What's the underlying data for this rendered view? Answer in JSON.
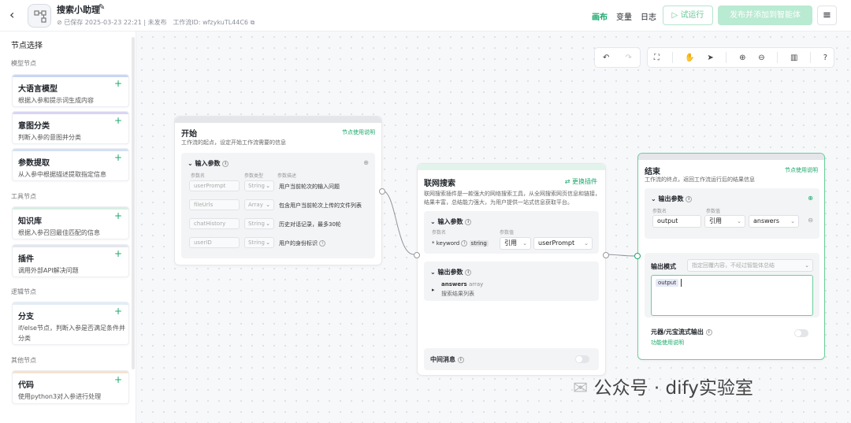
{
  "header": {
    "back_icon": "back-arrow-icon",
    "app_title": "搜索小助理",
    "meta": "已保存 2025-03-23 22:21 | 未发布",
    "workflow_id": "工作流ID: wfzykuTL44C6",
    "tabs": [
      {
        "label": "画布",
        "active": true
      },
      {
        "label": "变量",
        "active": false
      },
      {
        "label": "日志",
        "active": false
      }
    ],
    "run_label": "试运行",
    "publish_label": "发布并添加到智能体"
  },
  "sidebar": {
    "title": "节点选择",
    "sections": [
      {
        "label": "模型节点",
        "nodes": [
          {
            "title": "大语言模型",
            "desc": "根据入参和提示词生成内容",
            "color": "#c9d6f5"
          },
          {
            "title": "意图分类",
            "desc": "判断入参的意图并分类",
            "color": "#d9d4f3"
          },
          {
            "title": "参数提取",
            "desc": "从入参中根据描述提取指定信息",
            "color": "#d4dff4"
          }
        ]
      },
      {
        "label": "工具节点",
        "nodes": [
          {
            "title": "知识库",
            "desc": "根据入参召回最佳匹配的信息",
            "color": "#d9efe4"
          },
          {
            "title": "插件",
            "desc": "调用外部API解决问题",
            "color": "#e3e7ee"
          }
        ]
      },
      {
        "label": "逻辑节点",
        "nodes": [
          {
            "title": "分支",
            "desc": "if/else节点，判断入参是否满足条件并分类",
            "color": "#e3ecf7"
          }
        ]
      },
      {
        "label": "其他节点",
        "nodes": [
          {
            "title": "代码",
            "desc": "使用python3对入参进行处理",
            "color": "#f6e2cf"
          }
        ]
      }
    ]
  },
  "canvas": {
    "start": {
      "title": "开始",
      "link": "节点使用说明",
      "desc": "工作流的起点，设定开始工作流需要的信息",
      "input_label": "输入参数",
      "col_name": "参数名",
      "col_type": "参数类型",
      "col_desc": "参数描述",
      "rows": [
        {
          "name": "userPrompt",
          "type": "String",
          "desc": "用户当前轮次的输入问题"
        },
        {
          "name": "fileUrls",
          "type": "Array",
          "desc": "包含用户当前轮次上传的文件列表"
        },
        {
          "name": "chatHistory",
          "type": "String",
          "desc": "历史对话记录，最多30轮"
        },
        {
          "name": "userID",
          "type": "String",
          "desc": "用户的身份标识"
        }
      ]
    },
    "search": {
      "title": "联网搜索",
      "link": "更换插件",
      "desc": "联网搜索插件是一款强大的网络搜索工具，从全网搜索网页信息和链接，结果丰富，总结能力强大，为用户提供一站式信息获取平台。",
      "input_label": "输入参数",
      "col_name": "参数名",
      "col_value": "参数值",
      "param_name": "keyword",
      "param_type": "string",
      "param_source": "引用",
      "param_value": "userPrompt",
      "output_label": "输出参数",
      "out_name": "answers",
      "out_type": "array",
      "out_desc": "搜索结果列表",
      "middle_label": "中间消息"
    },
    "end": {
      "title": "结束",
      "link": "节点使用说明",
      "desc": "工作流的终点，返回工作流运行后的结果信息",
      "output_label": "输出参数",
      "col_name": "参数名",
      "col_value": "参数值",
      "out_name": "output",
      "out_source": "引用",
      "out_value": "answers",
      "mode_label": "输出模式",
      "mode_placeholder": "指定回覆内容，不经过智能体总结",
      "text_token": "output",
      "stream_label": "元器/元宝流式输出",
      "stream_link": "功能使用说明"
    }
  },
  "watermark": "公众号 · dify实验室"
}
